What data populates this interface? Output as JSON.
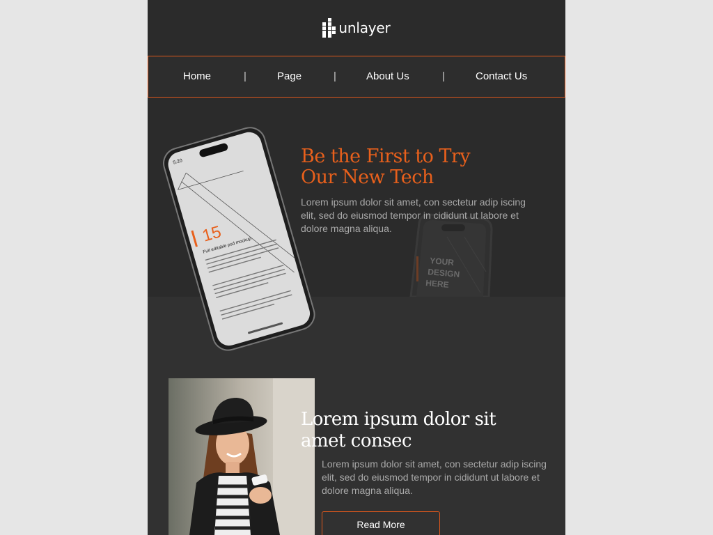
{
  "logo": {
    "text": "unlayer",
    "icon": "unlayer-logo-icon"
  },
  "nav": {
    "items": [
      "Home",
      "Page",
      "About Us",
      "Contact Us"
    ],
    "separator": "|"
  },
  "hero": {
    "title_line1": "Be the First to Try",
    "title_line2": "Our New Tech",
    "body": "Lorem ipsum dolor sit amet, con sectetur adip iscing elit, sed do eiusmod tempor in cididunt ut labore et dolore magna aliqua.",
    "phone_screen": {
      "time": "5:20",
      "number": "15",
      "subtitle": "Full editable psd mockup"
    },
    "back_phone_text": [
      "YOUR",
      "DESIGN",
      "HERE"
    ]
  },
  "feature": {
    "title_line1": "Lorem ipsum dolor sit",
    "title_line2": "amet consec",
    "body": "Lorem ipsum dolor sit amet, con sectetur adip iscing elit, sed do eiusmod tempor in cididunt ut labore et dolore magna aliqua.",
    "button": "Read More"
  },
  "colors": {
    "background": "#2b2b2b",
    "accent": "#e8601c",
    "page": "#e6e6e6",
    "muted_text": "#a9a9a9"
  }
}
